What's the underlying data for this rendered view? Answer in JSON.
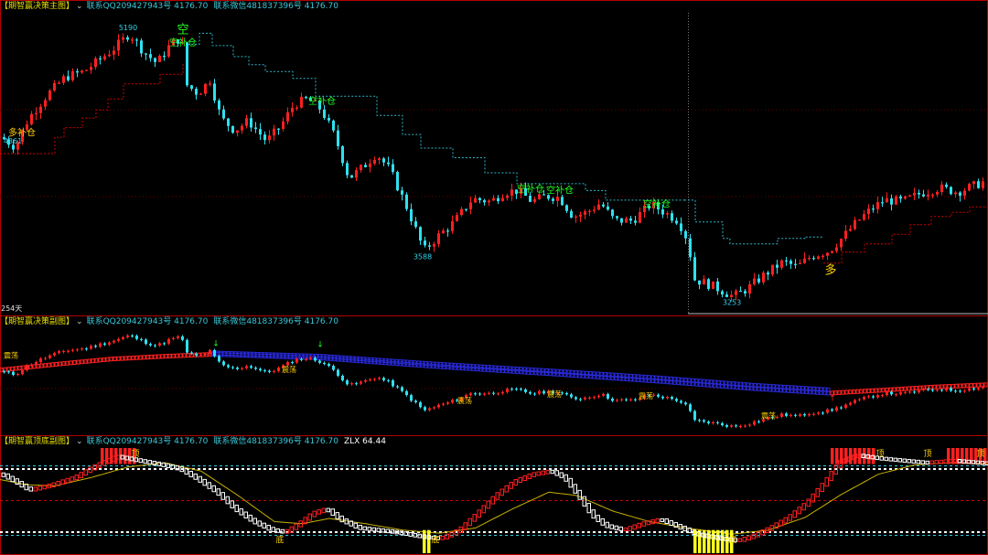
{
  "panels": {
    "main": {
      "title": "【期智赢决策主图】",
      "contact_qq": "联系QQ209427943号 4176.70",
      "contact_wx": "联系微信481837396号 4176.70",
      "days_label": "254天"
    },
    "sub1": {
      "title": "【期智赢决策副图】",
      "contact_qq": "联系QQ209427943号 4176.70",
      "contact_wx": "联系微信481837396号 4176.70"
    },
    "sub2": {
      "title": "【期智赢顶底副图】",
      "contact_qq": "联系QQ209427943号 4176.70",
      "contact_wx": "联系微信481837396号 4176.70",
      "zlx_label": "ZLX 64.44"
    }
  },
  "colors": {
    "up": "#ff2020",
    "down": "#30e0f0",
    "band": "#2828d8",
    "grid": "#b00000",
    "white": "#ffffff",
    "yellow": "#ffff20",
    "green": "#20ff20",
    "label_yellow": "#ffd000",
    "line_yellow": "#c8b000",
    "price_label": "#30d0e8"
  },
  "chart_data": [
    {
      "type": "candlestick",
      "name": "main",
      "ylim": [
        3150,
        5330
      ],
      "price_labels": [
        {
          "text": "5190",
          "x": 140,
          "y": 5190
        },
        {
          "text": "4361",
          "x": 14,
          "y": 4361
        },
        {
          "text": "3588",
          "x": 462,
          "y": 3588
        },
        {
          "text": "3253",
          "x": 800,
          "y": 3253
        }
      ],
      "signal_labels": [
        {
          "text": "多补仓",
          "x": 24,
          "y": 4430,
          "color": "yellow"
        },
        {
          "text": "空",
          "x": 200,
          "y": 5180,
          "color": "green"
        },
        {
          "text": "空补仓",
          "x": 200,
          "y": 5090,
          "color": "green"
        },
        {
          "text": "空补仓",
          "x": 352,
          "y": 4660,
          "color": "green"
        },
        {
          "text": "空补仓",
          "x": 580,
          "y": 4020,
          "color": "green"
        },
        {
          "text": "空补仓",
          "x": 612,
          "y": 4010,
          "color": "green"
        },
        {
          "text": "空补仓",
          "x": 718,
          "y": 3910,
          "color": "green"
        },
        {
          "text": "多",
          "x": 908,
          "y": 3420,
          "color": "yellow"
        }
      ],
      "anchors": [
        [
          0,
          4420
        ],
        [
          15,
          4350
        ],
        [
          30,
          4560
        ],
        [
          50,
          4730
        ],
        [
          70,
          4860
        ],
        [
          90,
          4900
        ],
        [
          110,
          5000
        ],
        [
          125,
          5080
        ],
        [
          140,
          5180
        ],
        [
          155,
          5050
        ],
        [
          170,
          4960
        ],
        [
          185,
          5100
        ],
        [
          197,
          5150
        ],
        [
          203,
          4800
        ],
        [
          215,
          4740
        ],
        [
          228,
          4840
        ],
        [
          240,
          4560
        ],
        [
          255,
          4470
        ],
        [
          270,
          4540
        ],
        [
          290,
          4390
        ],
        [
          305,
          4500
        ],
        [
          320,
          4660
        ],
        [
          335,
          4700
        ],
        [
          350,
          4620
        ],
        [
          365,
          4420
        ],
        [
          380,
          4120
        ],
        [
          395,
          4200
        ],
        [
          410,
          4300
        ],
        [
          425,
          4180
        ],
        [
          445,
          3880
        ],
        [
          462,
          3590
        ],
        [
          478,
          3700
        ],
        [
          495,
          3800
        ],
        [
          515,
          3970
        ],
        [
          535,
          3950
        ],
        [
          550,
          4020
        ],
        [
          565,
          4030
        ],
        [
          580,
          3950
        ],
        [
          595,
          3990
        ],
        [
          610,
          3980
        ],
        [
          625,
          3840
        ],
        [
          640,
          3870
        ],
        [
          655,
          3940
        ],
        [
          670,
          3810
        ],
        [
          690,
          3810
        ],
        [
          710,
          3930
        ],
        [
          725,
          3870
        ],
        [
          740,
          3810
        ],
        [
          750,
          3670
        ],
        [
          758,
          3380
        ],
        [
          775,
          3340
        ],
        [
          790,
          3290
        ],
        [
          800,
          3255
        ],
        [
          815,
          3310
        ],
        [
          835,
          3420
        ],
        [
          855,
          3510
        ],
        [
          870,
          3470
        ],
        [
          885,
          3550
        ],
        [
          905,
          3590
        ],
        [
          920,
          3690
        ],
        [
          935,
          3800
        ],
        [
          950,
          3890
        ],
        [
          965,
          3960
        ],
        [
          985,
          3950
        ],
        [
          1005,
          4010
        ],
        [
          1025,
          4050
        ],
        [
          1045,
          4020
        ],
        [
          1065,
          4070
        ],
        [
          1080,
          4110
        ]
      ],
      "stop_line_red": [
        [
          0,
          4300
        ],
        [
          60,
          4300
        ],
        [
          60,
          4420
        ],
        [
          70,
          4420
        ],
        [
          70,
          4490
        ],
        [
          90,
          4490
        ],
        [
          90,
          4560
        ],
        [
          105,
          4560
        ],
        [
          105,
          4620
        ],
        [
          118,
          4620
        ],
        [
          118,
          4700
        ],
        [
          135,
          4700
        ],
        [
          135,
          4810
        ],
        [
          175,
          4810
        ],
        [
          175,
          4880
        ],
        [
          200,
          4880
        ],
        [
          200,
          4950
        ],
        [
          205,
          4950
        ]
      ],
      "stop_line_teal_1": [
        [
          205,
          5100
        ],
        [
          218,
          5100
        ],
        [
          218,
          5180
        ],
        [
          232,
          5180
        ],
        [
          232,
          5090
        ],
        [
          255,
          5090
        ],
        [
          255,
          5010
        ],
        [
          272,
          5010
        ],
        [
          272,
          4950
        ],
        [
          290,
          4950
        ],
        [
          290,
          4900
        ],
        [
          320,
          4900
        ],
        [
          320,
          4850
        ],
        [
          345,
          4850
        ],
        [
          345,
          4720
        ],
        [
          412,
          4720
        ],
        [
          412,
          4580
        ],
        [
          440,
          4580
        ],
        [
          440,
          4440
        ],
        [
          460,
          4440
        ],
        [
          460,
          4340
        ],
        [
          495,
          4340
        ],
        [
          495,
          4270
        ],
        [
          530,
          4270
        ],
        [
          530,
          4160
        ],
        [
          565,
          4160
        ],
        [
          565,
          4080
        ],
        [
          640,
          4080
        ],
        [
          640,
          4030
        ],
        [
          662,
          4030
        ],
        [
          662,
          3960
        ],
        [
          748,
          3960
        ]
      ],
      "stop_line_teal_2": [
        [
          748,
          3960
        ],
        [
          760,
          3960
        ],
        [
          760,
          3800
        ],
        [
          790,
          3800
        ],
        [
          790,
          3680
        ],
        [
          798,
          3680
        ],
        [
          798,
          3640
        ],
        [
          850,
          3640
        ],
        [
          850,
          3680
        ],
        [
          880,
          3680
        ],
        [
          880,
          3690
        ],
        [
          900,
          3690
        ]
      ],
      "stop_line_red_2": [
        [
          900,
          3500
        ],
        [
          920,
          3500
        ],
        [
          920,
          3580
        ],
        [
          945,
          3580
        ],
        [
          945,
          3640
        ],
        [
          975,
          3640
        ],
        [
          975,
          3710
        ],
        [
          995,
          3710
        ],
        [
          995,
          3780
        ],
        [
          1018,
          3780
        ],
        [
          1018,
          3840
        ],
        [
          1040,
          3840
        ],
        [
          1040,
          3870
        ],
        [
          1060,
          3870
        ],
        [
          1060,
          3910
        ],
        [
          1080,
          3910
        ]
      ],
      "bottom_marker_y": 3170
    },
    {
      "type": "candlestick",
      "name": "sub1",
      "ylim": [
        3150,
        5330
      ],
      "band_line": {
        "up_range": [
          [
            0,
            130
          ]
        ],
        "down_range": [
          [
            232,
            905
          ]
        ],
        "up_range_2": [
          [
            905,
            1080
          ]
        ]
      },
      "band_points": [
        [
          0,
          4450
        ],
        [
          60,
          4570
        ],
        [
          120,
          4680
        ],
        [
          180,
          4740
        ],
        [
          232,
          4780
        ],
        [
          350,
          4700
        ],
        [
          470,
          4530
        ],
        [
          600,
          4370
        ],
        [
          720,
          4210
        ],
        [
          820,
          4060
        ],
        [
          905,
          3960
        ],
        [
          960,
          4020
        ],
        [
          1020,
          4090
        ],
        [
          1080,
          4140
        ]
      ],
      "band_points_top": [
        [
          232,
          4810
        ],
        [
          350,
          4740
        ],
        [
          470,
          4580
        ],
        [
          600,
          4430
        ],
        [
          720,
          4280
        ],
        [
          820,
          4130
        ],
        [
          905,
          4030
        ]
      ],
      "labels": [
        {
          "text": "震荡",
          "x": 12,
          "y": 4700
        },
        {
          "text": "震荡",
          "x": 316,
          "y": 4400
        },
        {
          "text": "震荡",
          "x": 508,
          "y": 3750
        },
        {
          "text": "震荡",
          "x": 606,
          "y": 3880
        },
        {
          "text": "震荡",
          "x": 706,
          "y": 3840
        },
        {
          "text": "震荡",
          "x": 840,
          "y": 3430
        }
      ],
      "arrows_down": [
        [
          236,
          4950
        ],
        [
          350,
          4930
        ]
      ],
      "arrows_up": [
        [
          910,
          3800
        ]
      ]
    },
    {
      "type": "oscillator",
      "name": "sub2",
      "ylim": [
        0,
        100
      ],
      "level_lines": [
        {
          "y": 83,
          "color": "cyan"
        },
        {
          "y": 80,
          "color": "white"
        },
        {
          "y": 50,
          "color": "red"
        },
        {
          "y": 20,
          "color": "white"
        },
        {
          "y": 17,
          "color": "cyan"
        }
      ],
      "zlx_value": 64.44,
      "top_labels": [
        {
          "text": "顶",
          "x": 148
        },
        {
          "text": "顶",
          "x": 962
        },
        {
          "text": "顶",
          "x": 1014
        },
        {
          "text": "顶",
          "x": 1072
        }
      ],
      "bottom_labels": [
        {
          "text": "底",
          "x": 306
        },
        {
          "text": "底",
          "x": 476
        },
        {
          "text": "底",
          "x": 801
        }
      ],
      "red_blocks_top": [
        [
          110,
          148
        ],
        [
          908,
          958
        ],
        [
          1035,
          1080
        ]
      ],
      "yellow_blocks_bottom": [
        [
          462,
          468
        ],
        [
          758,
          800
        ]
      ],
      "k_anchors": [
        [
          0,
          75
        ],
        [
          15,
          68
        ],
        [
          30,
          60
        ],
        [
          55,
          65
        ],
        [
          80,
          72
        ],
        [
          100,
          82
        ],
        [
          125,
          92
        ],
        [
          150,
          88
        ],
        [
          175,
          84
        ],
        [
          195,
          80
        ],
        [
          215,
          70
        ],
        [
          235,
          58
        ],
        [
          255,
          42
        ],
        [
          275,
          30
        ],
        [
          295,
          22
        ],
        [
          310,
          20
        ],
        [
          325,
          28
        ],
        [
          340,
          38
        ],
        [
          355,
          42
        ],
        [
          370,
          32
        ],
        [
          390,
          24
        ],
        [
          410,
          22
        ],
        [
          430,
          20
        ],
        [
          450,
          17
        ],
        [
          465,
          15
        ],
        [
          480,
          14
        ],
        [
          500,
          22
        ],
        [
          520,
          38
        ],
        [
          540,
          55
        ],
        [
          560,
          68
        ],
        [
          580,
          75
        ],
        [
          600,
          78
        ],
        [
          615,
          72
        ],
        [
          630,
          55
        ],
        [
          645,
          36
        ],
        [
          660,
          26
        ],
        [
          680,
          22
        ],
        [
          700,
          28
        ],
        [
          720,
          32
        ],
        [
          740,
          25
        ],
        [
          760,
          18
        ],
        [
          785,
          14
        ],
        [
          805,
          12
        ],
        [
          820,
          16
        ],
        [
          840,
          24
        ],
        [
          860,
          34
        ],
        [
          880,
          48
        ],
        [
          900,
          68
        ],
        [
          915,
          86
        ],
        [
          935,
          93
        ],
        [
          960,
          90
        ],
        [
          985,
          88
        ],
        [
          1010,
          86
        ],
        [
          1040,
          88
        ],
        [
          1080,
          85
        ]
      ],
      "d_anchors": [
        [
          0,
          70
        ],
        [
          30,
          65
        ],
        [
          60,
          64
        ],
        [
          100,
          72
        ],
        [
          140,
          82
        ],
        [
          180,
          86
        ],
        [
          220,
          78
        ],
        [
          260,
          55
        ],
        [
          300,
          30
        ],
        [
          330,
          28
        ],
        [
          360,
          33
        ],
        [
          400,
          28
        ],
        [
          440,
          22
        ],
        [
          480,
          19
        ],
        [
          520,
          24
        ],
        [
          560,
          42
        ],
        [
          600,
          58
        ],
        [
          630,
          55
        ],
        [
          670,
          40
        ],
        [
          710,
          30
        ],
        [
          750,
          24
        ],
        [
          800,
          18
        ],
        [
          840,
          22
        ],
        [
          880,
          34
        ],
        [
          920,
          56
        ],
        [
          960,
          75
        ],
        [
          1000,
          84
        ],
        [
          1040,
          86
        ],
        [
          1080,
          85
        ]
      ]
    }
  ]
}
